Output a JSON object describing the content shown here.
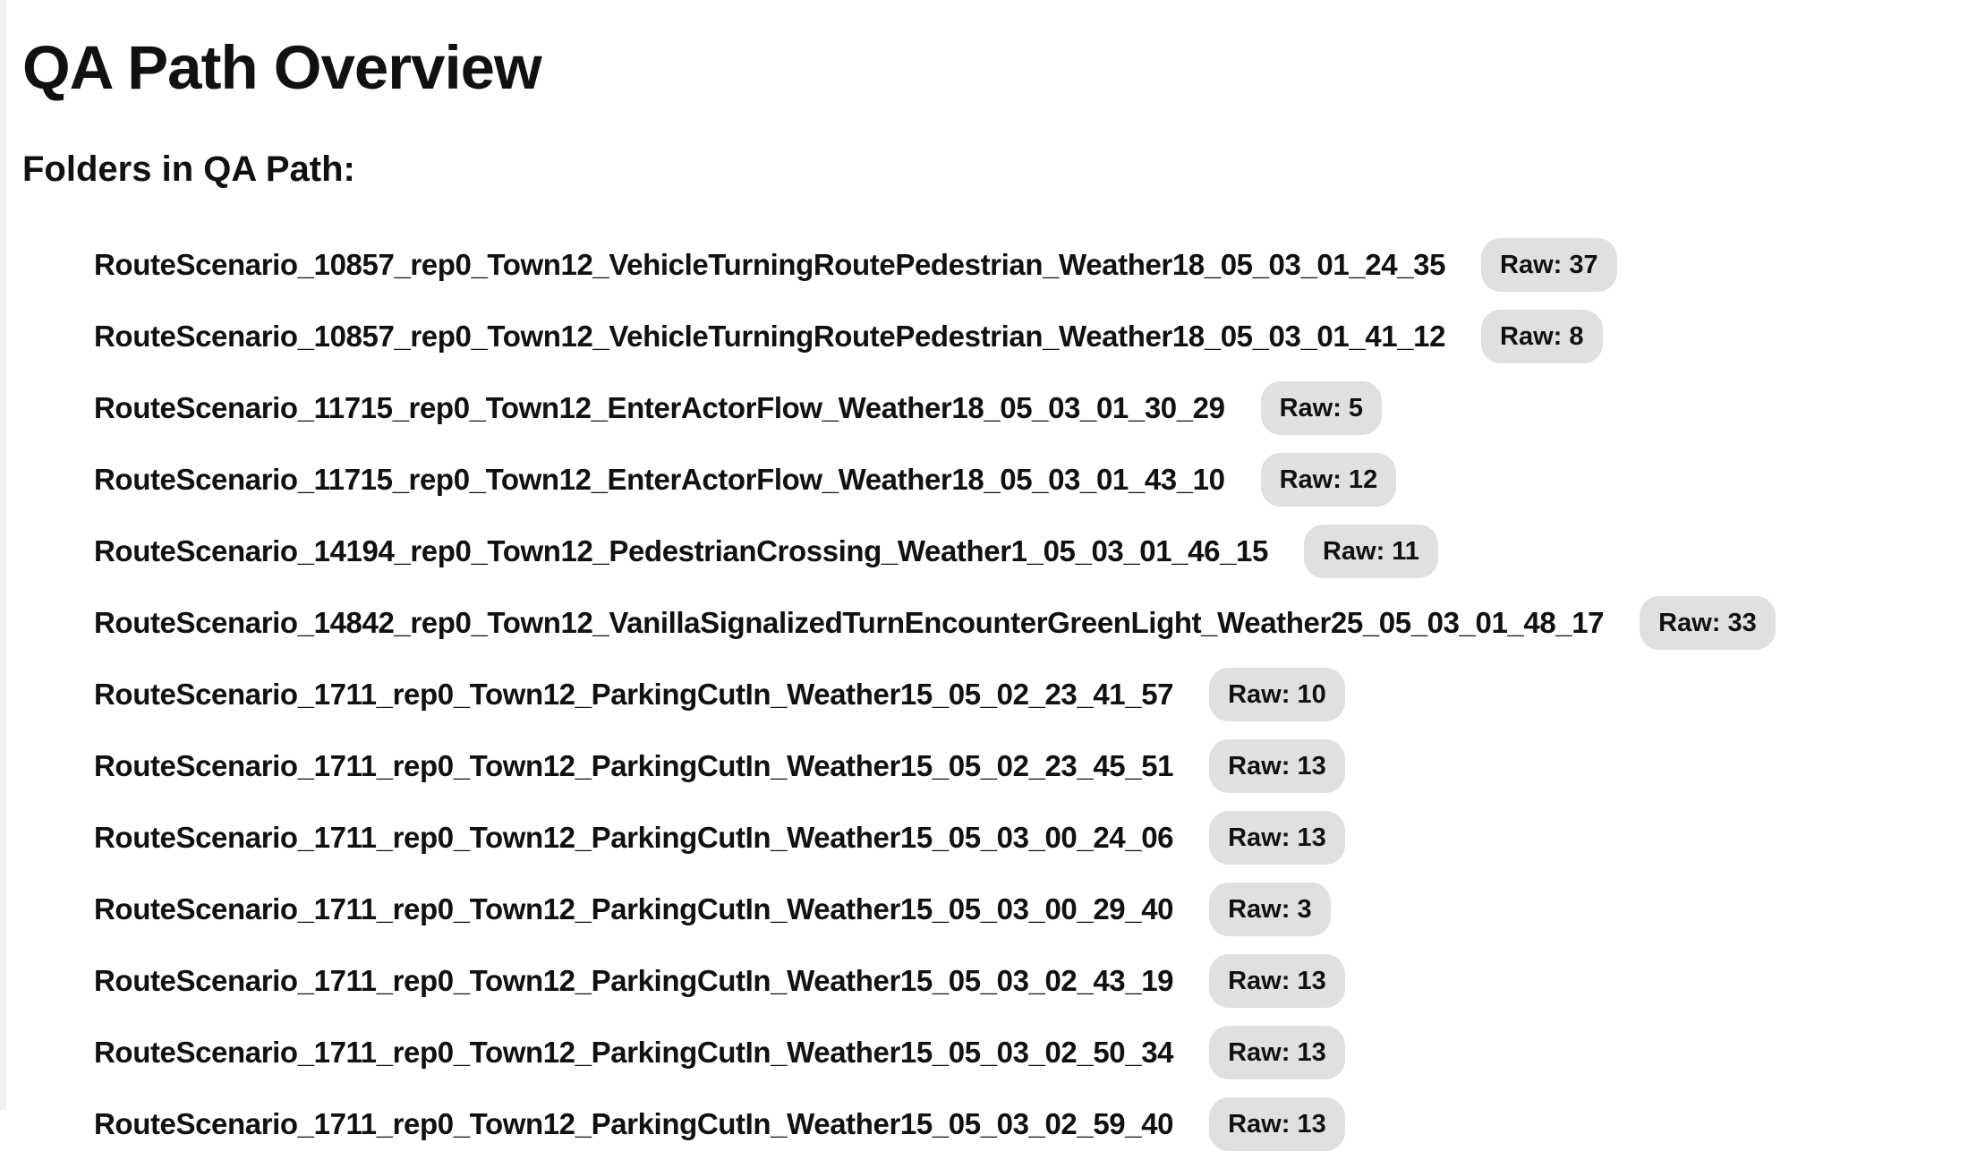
{
  "header": {
    "title": "QA Path Overview",
    "subtitle": "Folders in QA Path:"
  },
  "folders": [
    {
      "name": "RouteScenario_10857_rep0_Town12_VehicleTurningRoutePedestrian_Weather18_05_03_01_24_35",
      "raw": "Raw: 37"
    },
    {
      "name": "RouteScenario_10857_rep0_Town12_VehicleTurningRoutePedestrian_Weather18_05_03_01_41_12",
      "raw": "Raw: 8"
    },
    {
      "name": "RouteScenario_11715_rep0_Town12_EnterActorFlow_Weather18_05_03_01_30_29",
      "raw": "Raw: 5"
    },
    {
      "name": "RouteScenario_11715_rep0_Town12_EnterActorFlow_Weather18_05_03_01_43_10",
      "raw": "Raw: 12"
    },
    {
      "name": "RouteScenario_14194_rep0_Town12_PedestrianCrossing_Weather1_05_03_01_46_15",
      "raw": "Raw: 11"
    },
    {
      "name": "RouteScenario_14842_rep0_Town12_VanillaSignalizedTurnEncounterGreenLight_Weather25_05_03_01_48_17",
      "raw": "Raw: 33"
    },
    {
      "name": "RouteScenario_1711_rep0_Town12_ParkingCutIn_Weather15_05_02_23_41_57",
      "raw": "Raw: 10"
    },
    {
      "name": "RouteScenario_1711_rep0_Town12_ParkingCutIn_Weather15_05_02_23_45_51",
      "raw": "Raw: 13"
    },
    {
      "name": "RouteScenario_1711_rep0_Town12_ParkingCutIn_Weather15_05_03_00_24_06",
      "raw": "Raw: 13"
    },
    {
      "name": "RouteScenario_1711_rep0_Town12_ParkingCutIn_Weather15_05_03_00_29_40",
      "raw": "Raw: 3"
    },
    {
      "name": "RouteScenario_1711_rep0_Town12_ParkingCutIn_Weather15_05_03_02_43_19",
      "raw": "Raw: 13"
    },
    {
      "name": "RouteScenario_1711_rep0_Town12_ParkingCutIn_Weather15_05_03_02_50_34",
      "raw": "Raw: 13"
    },
    {
      "name": "RouteScenario_1711_rep0_Town12_ParkingCutIn_Weather15_05_03_02_59_40",
      "raw": "Raw: 13"
    }
  ]
}
